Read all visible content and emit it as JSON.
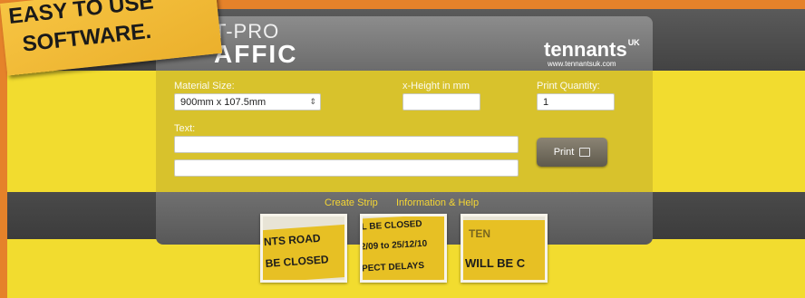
{
  "promo": {
    "line1": "EASY TO USE",
    "line2": "SOFTWARE."
  },
  "app": {
    "logo_top": "T-PRO",
    "logo_main": "AFFIC"
  },
  "brand": {
    "name": "tennants",
    "suffix": "UK",
    "url": "www.tennantsuk.com"
  },
  "form": {
    "material_size_label": "Material Size:",
    "material_size_value": "900mm x 107.5mm",
    "x_height_label": "x-Height in mm",
    "x_height_value": "",
    "print_quantity_label": "Print Quantity:",
    "print_quantity_value": "1",
    "text_label": "Text:",
    "text_line1": "",
    "text_line2": "",
    "print_button": "Print"
  },
  "nav": {
    "create_strip": "Create Strip",
    "info_help": "Information & Help"
  },
  "photos": [
    {
      "line1": "NTS ROAD",
      "line2": "BE CLOSED"
    },
    {
      "line1": "L BE CLOSED",
      "line2": "2/09 to 25/12/10",
      "line3": "PECT DELAYS"
    },
    {
      "line1": "TEN",
      "line2": "WILL BE C"
    }
  ],
  "colors": {
    "accent_yellow": "#f2dc2f",
    "frame_orange": "#e5822a",
    "nav_link": "#f5d634"
  }
}
